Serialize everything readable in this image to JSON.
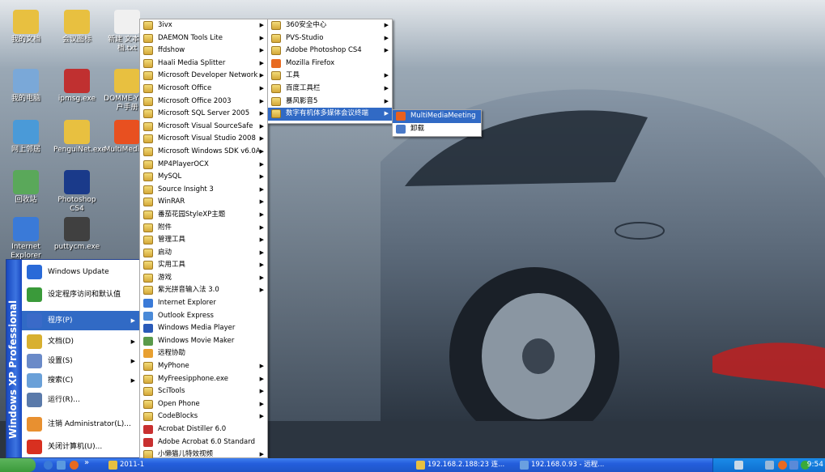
{
  "desktop_icons": [
    {
      "label": "我的文档",
      "color": "#e8c040"
    },
    {
      "label": "会议图标",
      "color": "#e8c040"
    },
    {
      "label": "新建 文本文档.txt",
      "color": "#f0f0f0"
    },
    {
      "label": "我的电脑",
      "color": "#7aa8d8"
    },
    {
      "label": "ipmsg.exe",
      "color": "#c03030"
    },
    {
      "label": "DOMME-Y1用户手册",
      "color": "#e8c040"
    },
    {
      "label": "网上邻居",
      "color": "#4a9ad8"
    },
    {
      "label": "PenguiNet.exe",
      "color": "#e8c040"
    },
    {
      "label": "MultiMediaM",
      "color": "#e85020"
    },
    {
      "label": "回收站",
      "color": "#5aa85a"
    },
    {
      "label": "Photoshop CS4",
      "color": "#1a3a8a"
    },
    {
      "label": "Internet Explorer",
      "color": "#3a7ad8"
    },
    {
      "label": "puttycm.exe",
      "color": "#404040"
    }
  ],
  "start_menu": {
    "side_text": "Windows XP Professional",
    "items": [
      {
        "label": "Windows Update",
        "color": "#2a6ad8"
      },
      {
        "label": "设定程序访问和默认值",
        "color": "#3a9a3a"
      },
      {
        "label": "程序(P)",
        "color": "#3a6ac8",
        "arrow": "▶",
        "selected": true
      },
      {
        "label": "文档(D)",
        "color": "#d8b030",
        "arrow": "▶"
      },
      {
        "label": "设置(S)",
        "color": "#6a8ac8",
        "arrow": "▶"
      },
      {
        "label": "搜索(C)",
        "color": "#6aa0d8",
        "arrow": "▶"
      },
      {
        "label": "运行(R)...",
        "color": "#5a7aaa"
      },
      {
        "label": "注销 Administrator(L)...",
        "color": "#e89030"
      },
      {
        "label": "关闭计算机(U)...",
        "color": "#d83020"
      }
    ]
  },
  "programs_menu": [
    {
      "label": "3ivx",
      "arrow": "▶"
    },
    {
      "label": "DAEMON Tools Lite",
      "arrow": "▶"
    },
    {
      "label": "ffdshow",
      "arrow": "▶"
    },
    {
      "label": "Haali Media Splitter",
      "arrow": "▶"
    },
    {
      "label": "Microsoft Developer Network",
      "arrow": "▶"
    },
    {
      "label": "Microsoft Office",
      "arrow": "▶"
    },
    {
      "label": "Microsoft Office 2003",
      "arrow": "▶"
    },
    {
      "label": "Microsoft SQL Server 2005",
      "arrow": "▶"
    },
    {
      "label": "Microsoft Visual SourceSafe",
      "arrow": "▶"
    },
    {
      "label": "Microsoft Visual Studio 2008",
      "arrow": "▶"
    },
    {
      "label": "Microsoft Windows SDK v6.0A",
      "arrow": "▶"
    },
    {
      "label": "MP4PlayerOCX",
      "arrow": "▶"
    },
    {
      "label": "MySQL",
      "arrow": "▶"
    },
    {
      "label": "Source Insight 3",
      "arrow": "▶"
    },
    {
      "label": "WinRAR",
      "arrow": "▶"
    },
    {
      "label": "番茄花园StyleXP主题",
      "arrow": "▶"
    },
    {
      "label": "附件",
      "arrow": "▶"
    },
    {
      "label": "管理工具",
      "arrow": "▶"
    },
    {
      "label": "启动",
      "arrow": "▶"
    },
    {
      "label": "实用工具",
      "arrow": "▶"
    },
    {
      "label": "游戏",
      "arrow": "▶"
    },
    {
      "label": "紫光拼音输入法 3.0",
      "arrow": "▶"
    },
    {
      "label": "Internet Explorer",
      "arrow": "",
      "icon": "#3a7ad8"
    },
    {
      "label": "Outlook Express",
      "arrow": "",
      "icon": "#4a8ad8"
    },
    {
      "label": "Windows Media Player",
      "arrow": "",
      "icon": "#2a5ab8"
    },
    {
      "label": "Windows Movie Maker",
      "arrow": "",
      "icon": "#5a9a4a"
    },
    {
      "label": "远程协助",
      "arrow": "",
      "icon": "#e8a030"
    },
    {
      "label": "MyPhone",
      "arrow": "▶"
    },
    {
      "label": "MyFreesipphone.exe",
      "arrow": "▶"
    },
    {
      "label": "SciTools",
      "arrow": "▶"
    },
    {
      "label": "Open Phone",
      "arrow": "▶"
    },
    {
      "label": "CodeBlocks",
      "arrow": "▶"
    },
    {
      "label": "Acrobat Distiller 6.0",
      "arrow": "",
      "icon": "#c83030"
    },
    {
      "label": "Adobe Acrobat 6.0 Standard",
      "arrow": "",
      "icon": "#c83030"
    },
    {
      "label": "小懒猫儿特效视频",
      "arrow": "▶"
    }
  ],
  "submenu_2": [
    {
      "label": "360安全中心",
      "arrow": "▶"
    },
    {
      "label": "PVS-Studio",
      "arrow": "▶"
    },
    {
      "label": "Adobe Photoshop CS4",
      "arrow": "▶"
    },
    {
      "label": "Mozilla Firefox",
      "arrow": "",
      "icon": "#e86a20"
    },
    {
      "label": "工具",
      "arrow": "▶"
    },
    {
      "label": "百度工具栏",
      "arrow": "▶"
    },
    {
      "label": "暴风影音5",
      "arrow": "▶"
    },
    {
      "label": "数字有机体多媒体会议终端",
      "arrow": "▶",
      "selected": true
    }
  ],
  "submenu_3": [
    {
      "label": "MultiMediaMeeting",
      "selected": true,
      "icon": "#e86020"
    },
    {
      "label": "卸载",
      "icon": "#4a7ac8"
    }
  ],
  "taskbar": {
    "quick_launch_more": "»",
    "items": [
      {
        "label": "2011-1",
        "color": "#e8c040"
      },
      {
        "label": "192.168.2.188:23 连...",
        "color": "#e8c040"
      },
      {
        "label": "192.168.0.93 - 远程...",
        "color": "#6aa0e0"
      }
    ],
    "clock": "9:54"
  }
}
